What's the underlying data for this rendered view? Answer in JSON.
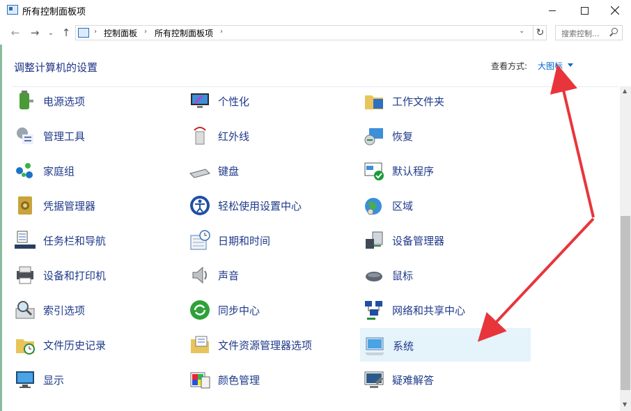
{
  "window": {
    "title": "所有控制面板项",
    "minimize_icon": "minimize-icon",
    "maximize_icon": "maximize-icon",
    "close_icon": "close-icon"
  },
  "nav": {
    "back_glyph": "←",
    "forward_glyph": "→",
    "recent_glyph": "⌄",
    "up_glyph": "↑",
    "breadcrumbs": [
      "控制面板",
      "所有控制面板项"
    ],
    "separator": "›",
    "dropdown_glyph": "⌄",
    "refresh_glyph": "↻",
    "search_placeholder": "搜索控制..."
  },
  "header": {
    "title": "调整计算机的设置",
    "view_by_label": "查看方式:",
    "view_by_value": "大图标"
  },
  "items": [
    {
      "label": "电源选项",
      "icon": "power-options-icon"
    },
    {
      "label": "个性化",
      "icon": "personalization-icon"
    },
    {
      "label": "工作文件夹",
      "icon": "work-folders-icon"
    },
    {
      "label": "管理工具",
      "icon": "admin-tools-icon"
    },
    {
      "label": "红外线",
      "icon": "infrared-icon"
    },
    {
      "label": "恢复",
      "icon": "recovery-icon"
    },
    {
      "label": "家庭组",
      "icon": "homegroup-icon"
    },
    {
      "label": "键盘",
      "icon": "keyboard-icon"
    },
    {
      "label": "默认程序",
      "icon": "default-programs-icon"
    },
    {
      "label": "凭据管理器",
      "icon": "credential-manager-icon"
    },
    {
      "label": "轻松使用设置中心",
      "icon": "ease-of-access-icon"
    },
    {
      "label": "区域",
      "icon": "region-icon"
    },
    {
      "label": "任务栏和导航",
      "icon": "taskbar-icon"
    },
    {
      "label": "日期和时间",
      "icon": "date-time-icon"
    },
    {
      "label": "设备管理器",
      "icon": "device-manager-icon"
    },
    {
      "label": "设备和打印机",
      "icon": "devices-printers-icon"
    },
    {
      "label": "声音",
      "icon": "sound-icon"
    },
    {
      "label": "鼠标",
      "icon": "mouse-icon"
    },
    {
      "label": "索引选项",
      "icon": "indexing-options-icon"
    },
    {
      "label": "同步中心",
      "icon": "sync-center-icon"
    },
    {
      "label": "网络和共享中心",
      "icon": "network-sharing-icon"
    },
    {
      "label": "文件历史记录",
      "icon": "file-history-icon"
    },
    {
      "label": "文件资源管理器选项",
      "icon": "explorer-options-icon"
    },
    {
      "label": "系统",
      "icon": "system-icon",
      "selected": true
    },
    {
      "label": "显示",
      "icon": "display-icon"
    },
    {
      "label": "颜色管理",
      "icon": "color-management-icon"
    },
    {
      "label": "疑难解答",
      "icon": "troubleshooting-icon"
    }
  ],
  "colors": {
    "link": "#1f3a8a",
    "header_title": "#1e3287",
    "view_by_value": "#0066cc",
    "selected_bg": "#e5f3fb",
    "annotation_arrow": "#e8353b"
  }
}
